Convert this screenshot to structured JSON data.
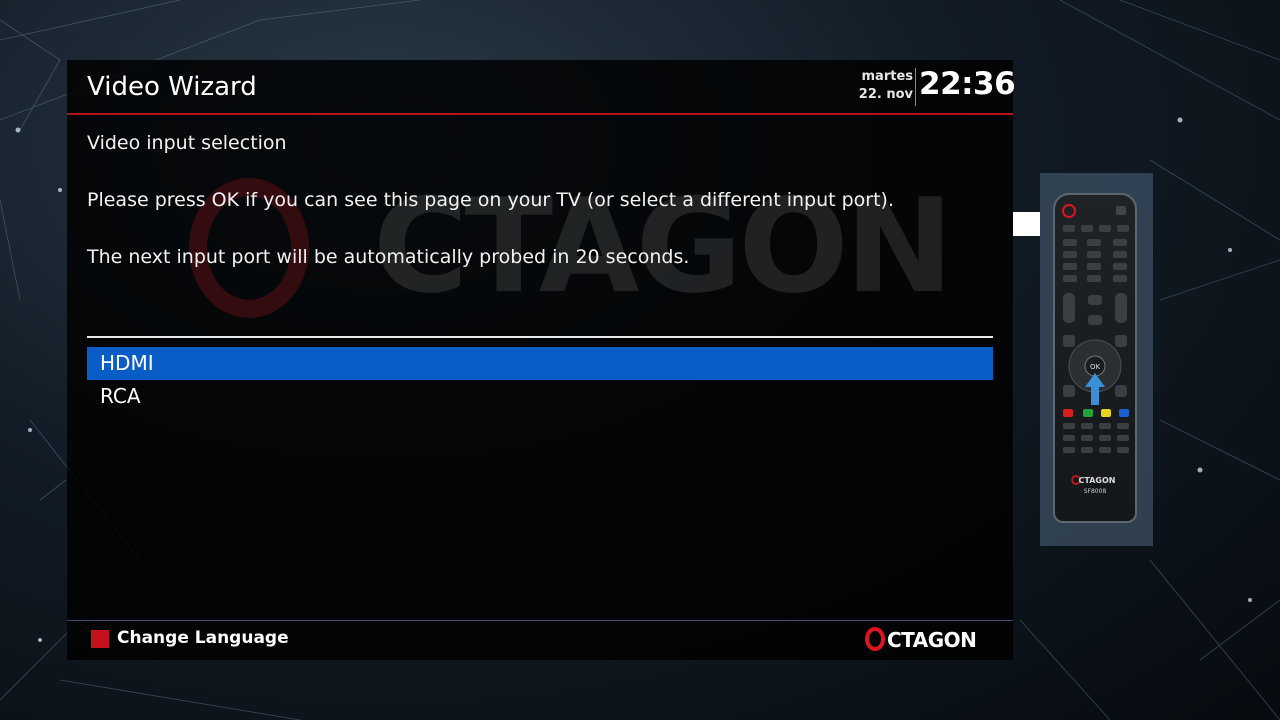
{
  "header": {
    "title": "Video Wizard",
    "weekday": "martes",
    "date": "22. nov",
    "time": "22:36"
  },
  "content": {
    "heading": "Video input selection",
    "instruction": "Please press OK if you can see this page on your TV (or select a different input port).",
    "countdown": "The next input port will be automatically probed in 20 seconds."
  },
  "inputs": [
    {
      "label": "HDMI",
      "selected": true
    },
    {
      "label": "RCA",
      "selected": false
    }
  ],
  "footer": {
    "red_label": "Change Language",
    "brand": "CTAGON"
  },
  "remote": {
    "model": "SF8008",
    "brand": "CTAGON",
    "highlight_key": "OK"
  },
  "colors": {
    "accent_red": "#c3121b",
    "selection_blue": "#0a5cc6"
  }
}
